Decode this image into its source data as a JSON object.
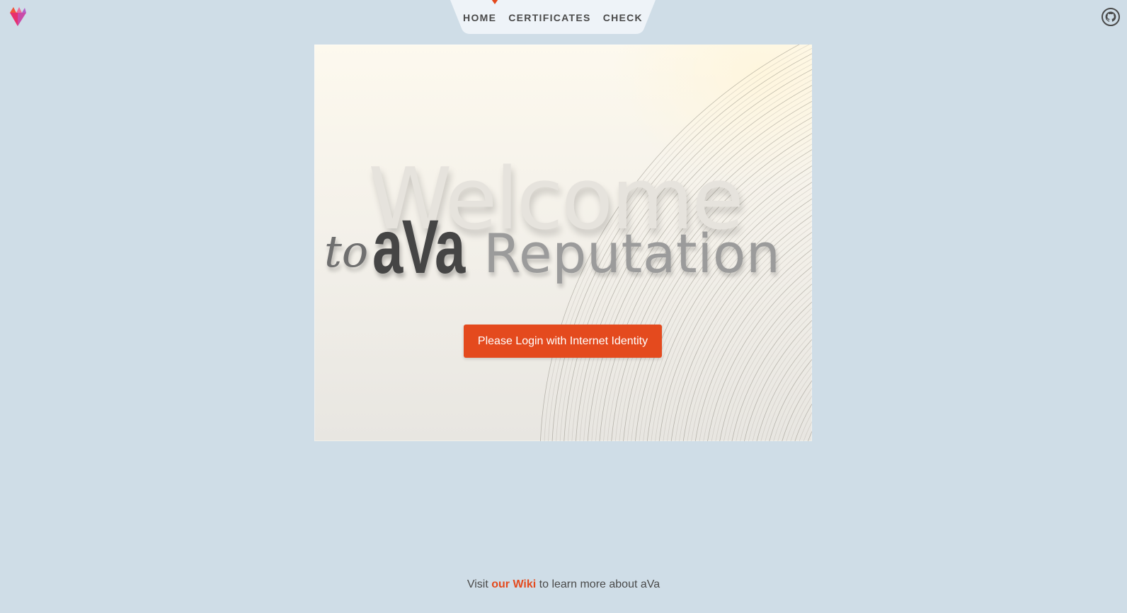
{
  "brand": {
    "logo_icon": "ava-gem-logo-icon",
    "accent_color": "#e44a1e",
    "background_color": "#cfdde7"
  },
  "nav": {
    "items": [
      {
        "label": "HOME",
        "active": true
      },
      {
        "label": "CERTIFICATES",
        "active": false
      },
      {
        "label": "CHECK",
        "active": false
      }
    ]
  },
  "header": {
    "github_icon": "github-icon"
  },
  "hero": {
    "welcome": "Welcome",
    "to": "to",
    "ava": "aVa",
    "reputation": "Reputation",
    "login_button": "Please Login with Internet Identity"
  },
  "footer": {
    "prefix": "Visit",
    "link": "our Wiki",
    "suffix": "to learn more about aVa"
  }
}
